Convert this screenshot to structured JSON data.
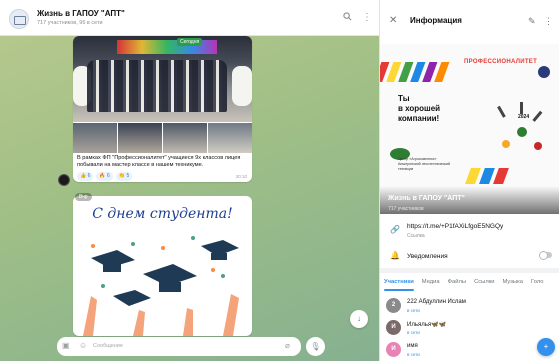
{
  "chat": {
    "title": "Жизнь в ГАПОУ \"АПТ\"",
    "subtitle": "717 участников, 96 в сети",
    "photo_tag": "Сегодня",
    "message1_text": "В рамках ФП \"Профессионалитет\" учащиеся 9х классов лицея побывали на мастер классе в нашем техникуме.",
    "message1_time": "20:10",
    "reactions": [
      {
        "emoji": "👍",
        "count": "6"
      },
      {
        "emoji": "🔥",
        "count": "6"
      },
      {
        "emoji": "👏",
        "count": "5"
      }
    ],
    "date_pill": "Вчр",
    "card_title": "С днем студента!",
    "composer_placeholder": "Сообщение",
    "icons": {
      "header_avatar": "channel-avatar-icon",
      "search": "search-icon",
      "more": "more-icon",
      "emoji": "emoji-icon",
      "attach": "attach-icon",
      "mic": "mic-icon",
      "scroll_down": "chevron-down-icon"
    }
  },
  "info": {
    "title": "Информация",
    "cover_name": "Жизнь в ГАПОУ \"АПТ\"",
    "cover_sub": "717 участников",
    "cover_text": {
      "brand": "ПРОФЕССИОНАЛИТЕТ",
      "headline_1": "Ты",
      "headline_2": "в хорошей",
      "headline_3": "компании!",
      "center_1": "Центр «Агрокомплекс»",
      "center_2": "Апшеронский лесотехнический",
      "center_3": "техникум",
      "year": "2024"
    },
    "link": "https://t.me/+P1fAXiLfgoE5NGQy",
    "link_label": "Ссылка",
    "notifications": "Уведомления",
    "tabs": [
      "Участники",
      "Медиа",
      "Файлы",
      "Ссылки",
      "Музыка",
      "Голо"
    ],
    "members": [
      {
        "name": "222 Абдуллин Ислам",
        "status": "в сети",
        "color": "#8a8a8a",
        "initial": "2"
      },
      {
        "name": "Ильялья🦋🦋",
        "status": "в сети",
        "color": "#7b6a6a",
        "initial": "И"
      },
      {
        "name": "имя",
        "status": "в сети",
        "color": "#e884b5",
        "initial": "И"
      }
    ],
    "icons": {
      "close": "close-icon",
      "edit": "pencil-icon",
      "more": "more-icon",
      "link": "link-icon",
      "bell": "bell-icon",
      "add_member": "add-user-icon"
    }
  }
}
